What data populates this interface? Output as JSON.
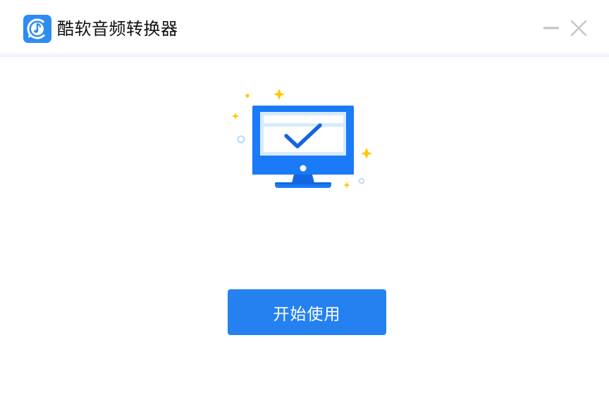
{
  "window": {
    "title": "酷软音频转换器",
    "app_icon": "music-note-refresh-icon",
    "controls": {
      "minimize_icon": "minimize-icon",
      "close_icon": "close-icon"
    }
  },
  "main": {
    "illustration_icon": "monitor-checkmark-icon",
    "start_button_label": "开始使用"
  },
  "colors": {
    "accent": "#2581f0",
    "monitor_blue": "#1a7af8",
    "sparkle_yellow": "#ffc907",
    "window_control_gray": "#c8c8c8"
  }
}
